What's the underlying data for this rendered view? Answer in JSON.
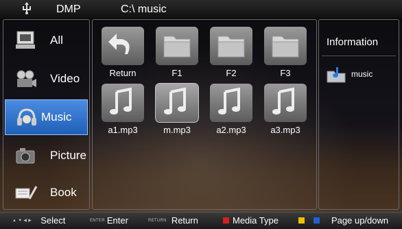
{
  "header": {
    "app_title": "DMP",
    "path": "C:\\ music"
  },
  "sidebar": {
    "items": [
      {
        "label": "All",
        "icon": "all-media-icon"
      },
      {
        "label": "Video",
        "icon": "video-camera-icon"
      },
      {
        "label": "Music",
        "icon": "music-headphones-icon",
        "active": true
      },
      {
        "label": "Picture",
        "icon": "picture-camera-icon"
      },
      {
        "label": "Book",
        "icon": "book-pen-icon"
      }
    ]
  },
  "grid": {
    "items": [
      {
        "label": "Return",
        "icon": "return-arrow-icon"
      },
      {
        "label": "F1",
        "icon": "folder-icon"
      },
      {
        "label": "F2",
        "icon": "folder-icon"
      },
      {
        "label": "F3",
        "icon": "folder-icon"
      },
      {
        "label": "a1.mp3",
        "icon": "music-note-icon"
      },
      {
        "label": "m.mp3",
        "icon": "music-note-icon",
        "selected": true
      },
      {
        "label": "a2.mp3",
        "icon": "music-note-icon"
      },
      {
        "label": "a3.mp3",
        "icon": "music-note-icon"
      }
    ]
  },
  "info": {
    "title": "Information",
    "name": "music",
    "icon": "music-folder-icon"
  },
  "footer": {
    "arrows_key": "▲ ▼ ◀ ▶",
    "select": "Select",
    "enter_key": "ENTER",
    "enter": "Enter",
    "return_key": "RETURN",
    "return": "Return",
    "media_type": "Media Type",
    "page": "Page up/down"
  },
  "colors": {
    "active_item": "#2f74cc",
    "red_key": "#d42020",
    "yellow_key": "#f0c000",
    "blue_key": "#2060d0"
  }
}
